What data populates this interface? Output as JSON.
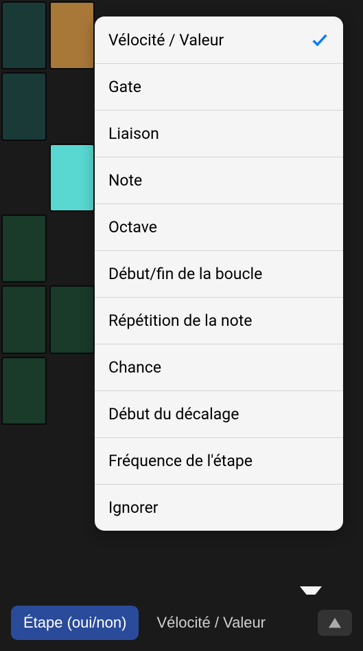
{
  "popup": {
    "items": [
      {
        "label": "Vélocité / Valeur",
        "selected": true
      },
      {
        "label": "Gate",
        "selected": false
      },
      {
        "label": "Liaison",
        "selected": false
      },
      {
        "label": "Note",
        "selected": false
      },
      {
        "label": "Octave",
        "selected": false
      },
      {
        "label": "Début/fin de la boucle",
        "selected": false
      },
      {
        "label": "Répétition de la note",
        "selected": false
      },
      {
        "label": "Chance",
        "selected": false
      },
      {
        "label": "Début du décalage",
        "selected": false
      },
      {
        "label": "Fréquence de l'étape",
        "selected": false
      },
      {
        "label": "Ignorer",
        "selected": false
      }
    ]
  },
  "bottomBar": {
    "tab1": "Étape (oui/non)",
    "tab2": "Vélocité / Valeur"
  }
}
